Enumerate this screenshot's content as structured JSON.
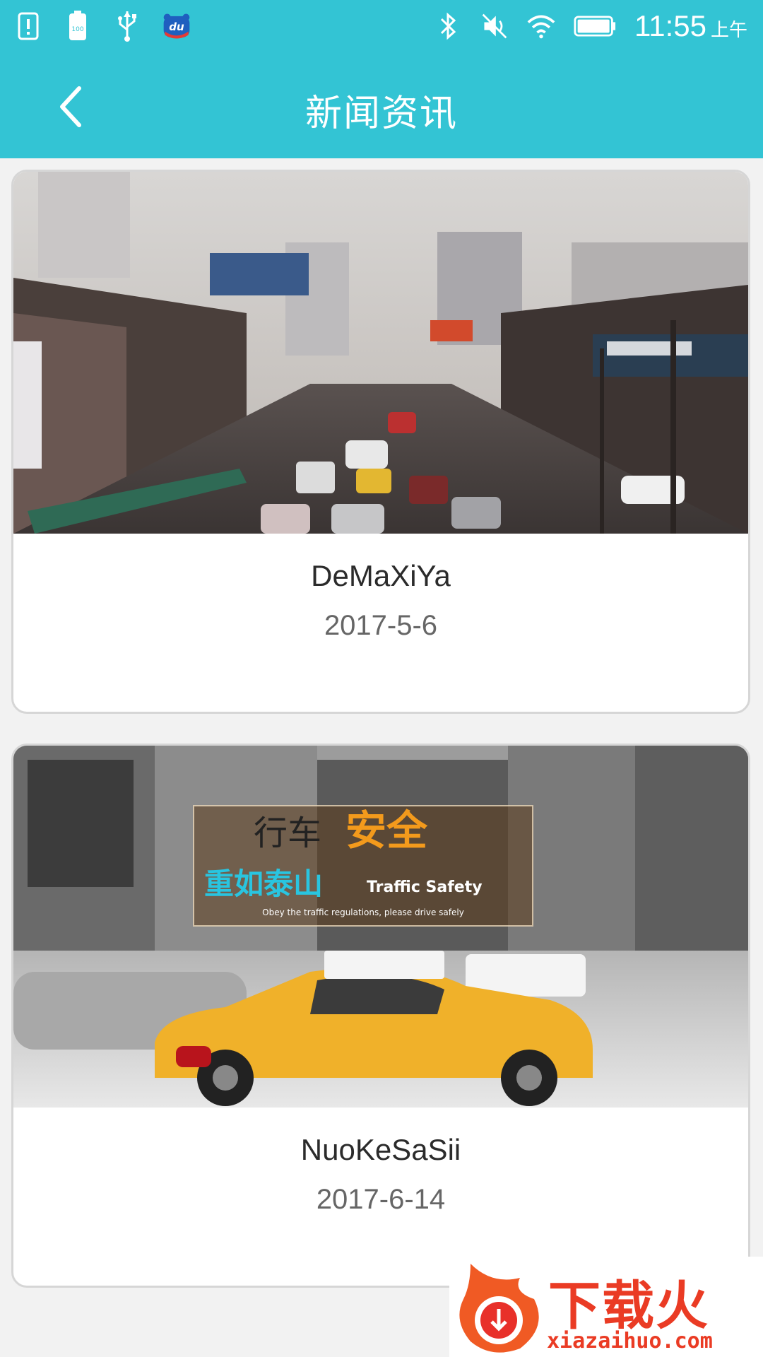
{
  "status_bar": {
    "time": "11:55",
    "ampm": "上午",
    "battery_label": "100"
  },
  "header": {
    "title": "新闻资讯",
    "accent_color": "#33c4d4"
  },
  "news": [
    {
      "title": "DeMaXiYa",
      "date": "2017-5-6"
    },
    {
      "title": "NuoKeSaSii",
      "date": "2017-6-14",
      "banner_title_1": "行车",
      "banner_title_2": "安全",
      "banner_title_3": "重如泰山",
      "banner_title_4": "Traffic Safety",
      "banner_subtitle": "Obey the traffic regulations, please drive safely"
    }
  ],
  "watermark": {
    "logo_text": "下载火",
    "url": "xiazaihuo.com"
  }
}
